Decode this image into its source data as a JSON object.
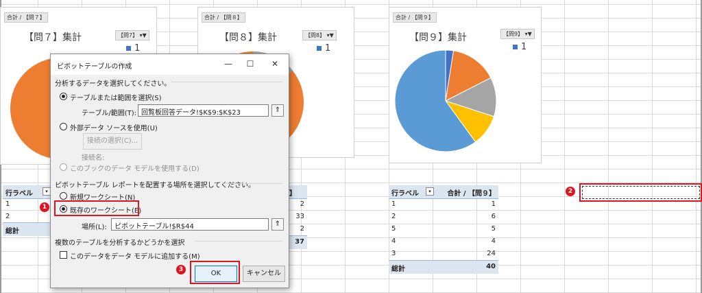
{
  "charts": [
    {
      "tag": "合計 / 【問７】",
      "title": "【問７】集計",
      "filter": "【問7】",
      "legend": "1"
    },
    {
      "tag": "合計 / 【問８】",
      "title": "【問８】集計",
      "filter": "【問8】",
      "legend": "1"
    },
    {
      "tag": "合計 / 【問９】",
      "title": "【問９】集計",
      "filter": "【問9】",
      "legend": "1"
    }
  ],
  "pie9_data": {
    "type": "pie",
    "slices": [
      {
        "value": 1,
        "color": "#4472c4"
      },
      {
        "value": 6,
        "color": "#ed7d31"
      },
      {
        "value": 5,
        "color": "#a5a5a5"
      },
      {
        "value": 4,
        "color": "#ffc000"
      },
      {
        "value": 24,
        "color": "#5b9bd5"
      }
    ]
  },
  "pivot7": {
    "header": "行ラベル",
    "rows": [
      "1",
      "2"
    ],
    "total": "総計"
  },
  "pivot8": {
    "header": "】",
    "values": [
      "2",
      "33",
      "2"
    ],
    "total": "37"
  },
  "pivot9": {
    "header_label": "行ラベル",
    "header_value": "合計 / 【問９】",
    "rows": [
      {
        "label": "1",
        "value": "1"
      },
      {
        "label": "2",
        "value": "6"
      },
      {
        "label": "5",
        "value": "5"
      },
      {
        "label": "4",
        "value": "4"
      },
      {
        "label": "3",
        "value": "24"
      }
    ],
    "total_label": "総計",
    "total_value": "40"
  },
  "dialog": {
    "title": "ピボットテーブルの作成",
    "minimize": "—",
    "maximize": "☐",
    "close": "✕",
    "section1": "分析するデータを選択してください。",
    "opt_table": "テーブルまたは範囲を選択(S)",
    "range_label": "テーブル/範囲(T):",
    "range_value": "回覧板回答データ!$K$9:$K$23",
    "opt_external": "外部データ ソースを使用(U)",
    "conn_button": "接続の選択(C)...",
    "conn_name": "接続名:",
    "opt_model": "このブックのデータ モデルを使用する(D)",
    "section2": "ピボットテーブル レポートを配置する場所を選択してください。",
    "opt_new": "新規ワークシート(N)",
    "opt_existing": "既存のワークシート(E)",
    "location_label": "場所(L):",
    "location_value": "ピボットテーブル!$R$44",
    "section3": "複数のテーブルを分析するかどうかを選択",
    "add_model": "このデータをデータ モデルに追加する(M)",
    "ok": "OK",
    "cancel": "キャンセル",
    "collapse_icon": "⇑"
  },
  "markers": [
    "1",
    "2",
    "3"
  ],
  "accent_red": "#e0141e"
}
